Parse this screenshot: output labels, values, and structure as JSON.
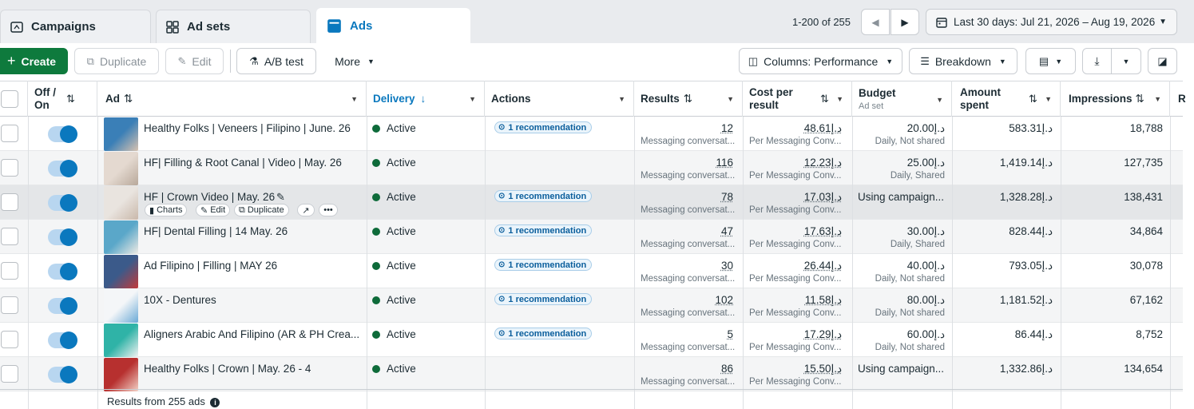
{
  "tabs": [
    {
      "label": "Campaigns"
    },
    {
      "label": "Ad sets"
    },
    {
      "label": "Ads"
    }
  ],
  "pager": {
    "range": "1-200 of 255",
    "prev": "◀",
    "next": "▶"
  },
  "date_range": "Last 30 days: Jul 21, 2026 – Aug 19, 2026",
  "toolbar": {
    "create": "Create",
    "duplicate": "Duplicate",
    "edit": "Edit",
    "ab_test": "A/B test",
    "more": "More",
    "columns": "Columns: Performance",
    "breakdown": "Breakdown"
  },
  "headers": {
    "off_on": "Off / On",
    "ad": "Ad",
    "delivery": "Delivery",
    "actions": "Actions",
    "results": "Results",
    "cost_per_result": "Cost per result",
    "budget": "Budget",
    "budget_sub": "Ad set",
    "amount_spent": "Amount spent",
    "impressions": "Impressions",
    "cut": "R"
  },
  "row_actions": {
    "charts": "Charts",
    "edit": "Edit",
    "duplicate": "Duplicate"
  },
  "rows": [
    {
      "name": "Healthy Folks | Veneers | Filipino | June. 26",
      "delivery": "Active",
      "rec": "1 recommendation",
      "results": "12",
      "results_sub": "Messaging conversat...",
      "cost": "48.61د.إ",
      "cost_sub": "Per Messaging Conv...",
      "budget": "20.00د.إ",
      "budget_sub": "Daily, Not shared",
      "spent": "583.31د.إ",
      "impressions": "18,788"
    },
    {
      "name": "HF| Filling & Root Canal | Video | May. 26",
      "delivery": "Active",
      "rec": "",
      "results": "116",
      "results_sub": "Messaging conversat...",
      "cost": "12.23د.إ",
      "cost_sub": "Per Messaging Conv...",
      "budget": "25.00د.إ",
      "budget_sub": "Daily, Shared",
      "spent": "1,419.14د.إ",
      "impressions": "127,735"
    },
    {
      "name": "HF | Crown Video | May. 26",
      "delivery": "Active",
      "rec": "1 recommendation",
      "results": "78",
      "results_sub": "Messaging conversat...",
      "cost": "17.03د.إ",
      "cost_sub": "Per Messaging Conv...",
      "budget": "Using campaign...",
      "budget_sub": "",
      "spent": "1,328.28د.إ",
      "impressions": "138,431"
    },
    {
      "name": "HF| Dental Filling | 14 May. 26",
      "delivery": "Active",
      "rec": "1 recommendation",
      "results": "47",
      "results_sub": "Messaging conversat...",
      "cost": "17.63د.إ",
      "cost_sub": "Per Messaging Conv...",
      "budget": "30.00د.إ",
      "budget_sub": "Daily, Shared",
      "spent": "828.44د.إ",
      "impressions": "34,864"
    },
    {
      "name": "Ad Filipino | Filling | MAY 26",
      "delivery": "Active",
      "rec": "1 recommendation",
      "results": "30",
      "results_sub": "Messaging conversat...",
      "cost": "26.44د.إ",
      "cost_sub": "Per Messaging Conv...",
      "budget": "40.00د.إ",
      "budget_sub": "Daily, Not shared",
      "spent": "793.05د.إ",
      "impressions": "30,078"
    },
    {
      "name": "10X - Dentures",
      "delivery": "Active",
      "rec": "1 recommendation",
      "results": "102",
      "results_sub": "Messaging conversat...",
      "cost": "11.58د.إ",
      "cost_sub": "Per Messaging Conv...",
      "budget": "80.00د.إ",
      "budget_sub": "Daily, Not shared",
      "spent": "1,181.52د.إ",
      "impressions": "67,162"
    },
    {
      "name": "Aligners Arabic And Filipino (AR & PH Crea...",
      "delivery": "Active",
      "rec": "1 recommendation",
      "results": "5",
      "results_sub": "Messaging conversat...",
      "cost": "17.29د.إ",
      "cost_sub": "Per Messaging Conv...",
      "budget": "60.00د.إ",
      "budget_sub": "Daily, Not shared",
      "spent": "86.44د.إ",
      "impressions": "8,752"
    },
    {
      "name": "Healthy Folks | Crown | May. 26 - 4",
      "delivery": "Active",
      "rec": "",
      "results": "86",
      "results_sub": "Messaging conversat...",
      "cost": "15.50د.إ",
      "cost_sub": "Per Messaging Conv...",
      "budget": "Using campaign...",
      "budget_sub": "",
      "spent": "1,332.86د.إ",
      "impressions": "134,654"
    }
  ],
  "footer": "Results from 255 ads",
  "colors": {
    "accent": "#0a78be",
    "create": "#0e7a3d",
    "active_dot": "#0e6b3a"
  }
}
